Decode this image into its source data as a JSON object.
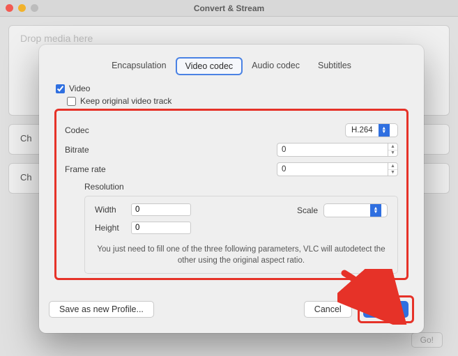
{
  "window": {
    "title": "Convert & Stream"
  },
  "outer": {
    "dropzone": "Drop media here",
    "ch1": "Ch",
    "ch2": "Ch",
    "go": "Go!"
  },
  "tabs": {
    "encapsulation": "Encapsulation",
    "video_codec": "Video codec",
    "audio_codec": "Audio codec",
    "subtitles": "Subtitles"
  },
  "video": {
    "checkbox_label": "Video",
    "keep_original": "Keep original video track",
    "codec_label": "Codec",
    "codec_value": "H.264",
    "bitrate_label": "Bitrate",
    "bitrate_value": "0",
    "framerate_label": "Frame rate",
    "framerate_value": "0",
    "resolution": {
      "group_label": "Resolution",
      "width_label": "Width",
      "width_value": "0",
      "height_label": "Height",
      "height_value": "0",
      "scale_label": "Scale",
      "scale_value": "",
      "hint": "You just need to fill one of the three following parameters, VLC will autodetect the other using the original aspect ratio."
    }
  },
  "footer": {
    "save_profile": "Save as new Profile...",
    "cancel": "Cancel",
    "apply": "Apply"
  }
}
